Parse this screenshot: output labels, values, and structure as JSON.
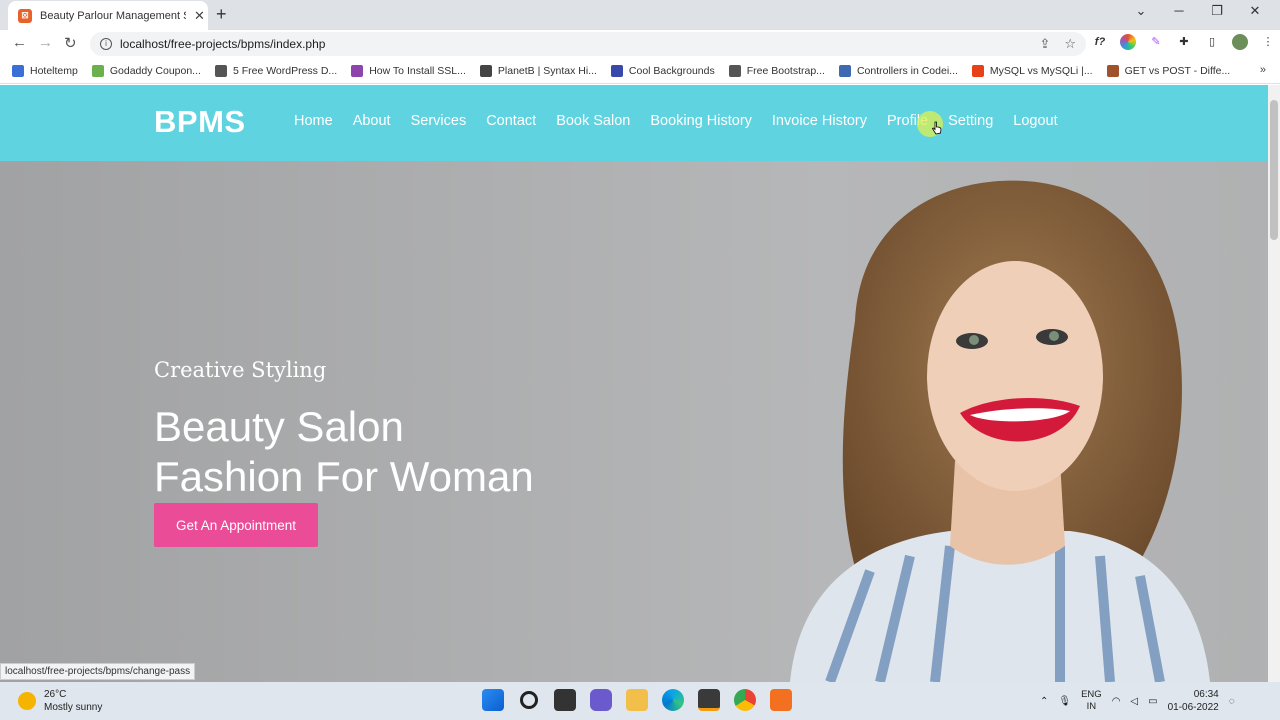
{
  "browser": {
    "tab_title": "Beauty Parlour Management Syste",
    "url": "localhost/free-projects/bpms/index.php",
    "status_url": "localhost/free-projects/bpms/change-pass",
    "bookmarks": [
      {
        "label": "Hoteltemp",
        "color": "#3b6fd8"
      },
      {
        "label": "Godaddy Coupon...",
        "color": "#6ab04c"
      },
      {
        "label": "5 Free WordPress D...",
        "color": "#555555"
      },
      {
        "label": "How To Install SSL...",
        "color": "#8e44ad"
      },
      {
        "label": "PlanetB | Syntax Hi...",
        "color": "#444444"
      },
      {
        "label": "Cool Backgrounds",
        "color": "#3949ab"
      },
      {
        "label": "Free Bootstrap...",
        "color": "#555555"
      },
      {
        "label": "Controllers in Codei...",
        "color": "#0097e6"
      },
      {
        "label": "Controllers in Codei...",
        "color": "#3d6ab3"
      },
      {
        "label": "MySQL vs MySQLi |...",
        "color": "#e84118"
      },
      {
        "label": "GET vs POST - Diffe...",
        "color": "#a0522d"
      }
    ]
  },
  "site": {
    "brand": "BPMS",
    "nav": [
      "Home",
      "About",
      "Services",
      "Contact",
      "Book Salon",
      "Booking History",
      "Invoice History",
      "Profile",
      "Setting",
      "Logout"
    ],
    "hero": {
      "subtitle": "Creative Styling",
      "title_line1": "Beauty Salon",
      "title_line2": "Fashion For Woman",
      "button": "Get An Appointment"
    }
  },
  "taskbar": {
    "temperature": "26°C",
    "weather": "Mostly sunny",
    "lang_top": "ENG",
    "lang_bottom": "IN",
    "time": "06:34",
    "date": "01-06-2022"
  },
  "colors": {
    "header": "#5fd3e0",
    "button": "#ea4c97"
  }
}
